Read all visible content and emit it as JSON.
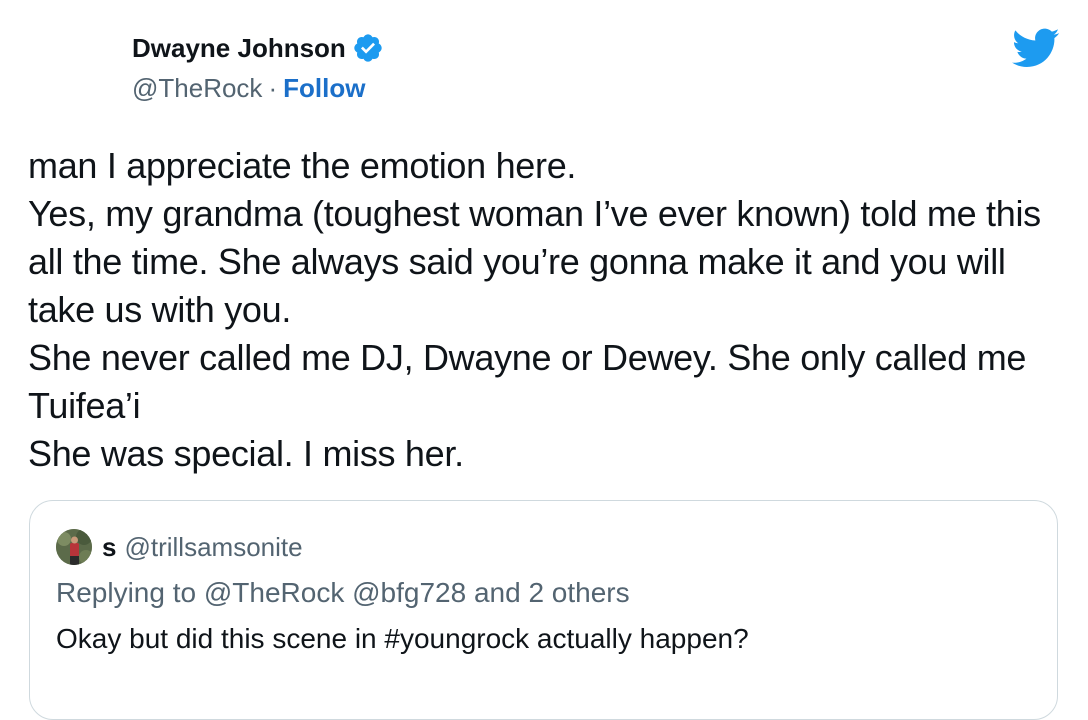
{
  "author": {
    "display_name": "Dwayne Johnson",
    "handle": "@TheRock",
    "separator": "·",
    "follow_label": "Follow",
    "verified": true
  },
  "tweet": {
    "text": "man I appreciate the emotion here.\nYes, my grandma (toughest woman I’ve ever known) told me this all the time. She always said you’re gonna make it and you will take us with you.\nShe never called me DJ, Dwayne or Dewey. She only called me Tuifea’i\nShe was special. I miss her."
  },
  "quoted_tweet": {
    "display_name": "s",
    "handle": "@trillsamsonite",
    "replying_prefix": "Replying to",
    "replying_to": "@TheRock @bfg728 and 2 others",
    "text": "Okay but did this scene in #youngrock actually happen?"
  },
  "icons": {
    "verified": "verified-badge-icon",
    "brand": "twitter-bird-icon",
    "avatar": "user-avatar"
  },
  "colors": {
    "brand_blue": "#1d9bf0",
    "link_blue": "#1b6fc9",
    "text_primary": "#0f1419",
    "text_secondary": "#536471",
    "border": "#cfd9de"
  }
}
